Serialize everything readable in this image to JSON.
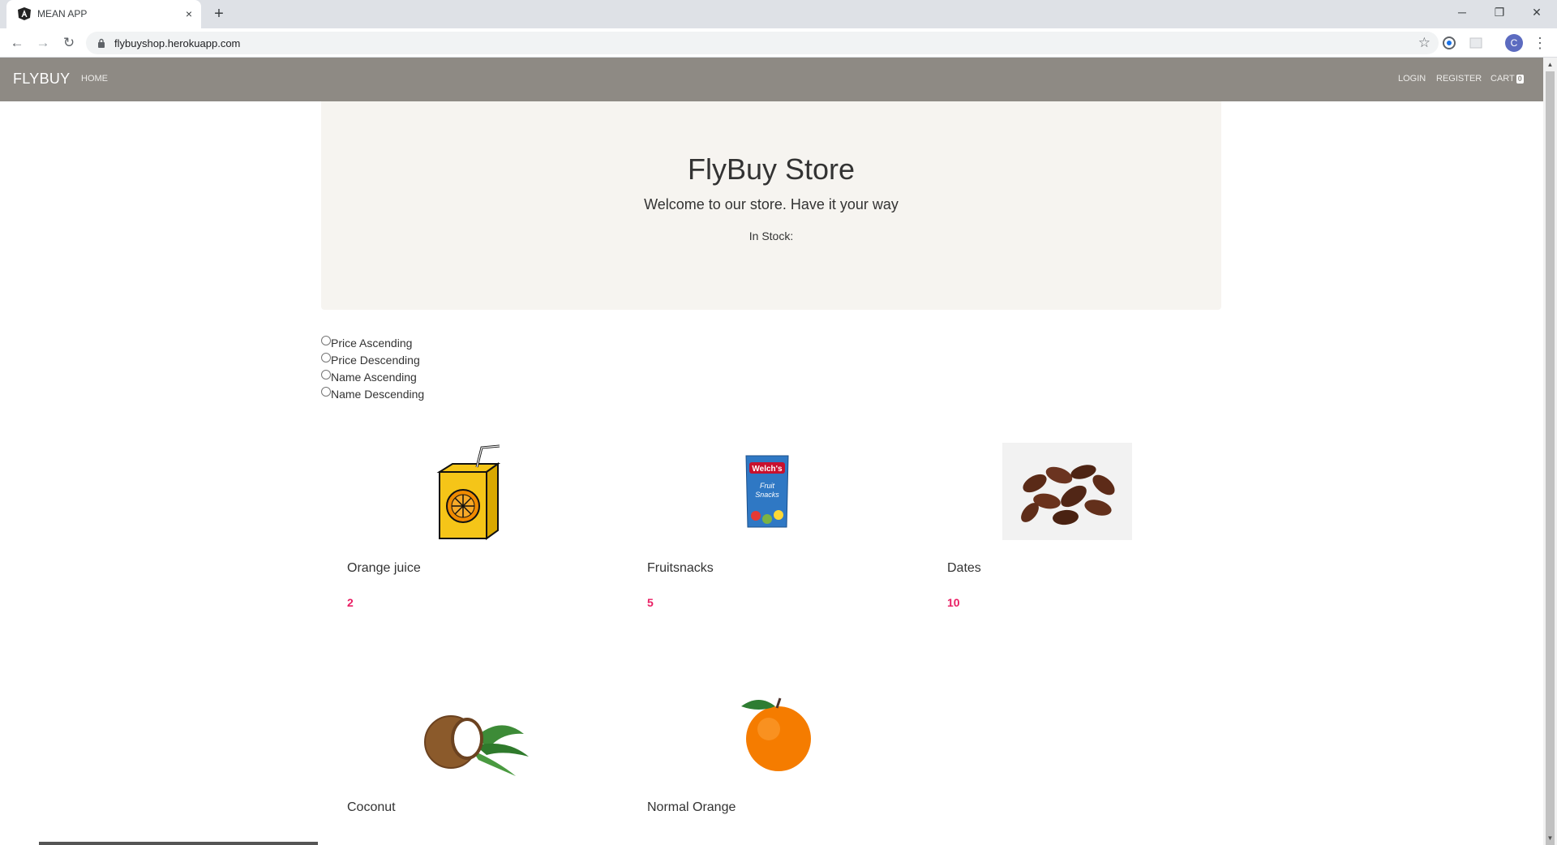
{
  "browser": {
    "tab_title": "MEAN APP",
    "tab_close": "×",
    "new_tab": "+",
    "url": "flybuyshop.herokuapp.com",
    "profile_initial": "C",
    "window": {
      "minimize": "─",
      "restore": "❐",
      "close": "✕"
    }
  },
  "navbar": {
    "brand": "FLYBUY",
    "home": "HOME",
    "login": "LOGIN",
    "register": "REGISTER",
    "cart": "CART",
    "cart_count": "0"
  },
  "jumbotron": {
    "title": "FlyBuy Store",
    "subtitle": "Welcome to our store. Have it your way",
    "stock_label": "In Stock:"
  },
  "sort_options": [
    "Price Ascending",
    "Price Descending",
    "Name Ascending",
    "Name Descending"
  ],
  "products": [
    {
      "name": "Orange juice",
      "price": "2"
    },
    {
      "name": "Fruitsnacks",
      "price": "5"
    },
    {
      "name": "Dates",
      "price": "10"
    },
    {
      "name": "Coconut",
      "price": ""
    },
    {
      "name": "Normal Orange",
      "price": ""
    }
  ],
  "colors": {
    "navbar": "#8e8a84",
    "jumbotron": "#f6f4f0",
    "price": "#e91e63"
  }
}
